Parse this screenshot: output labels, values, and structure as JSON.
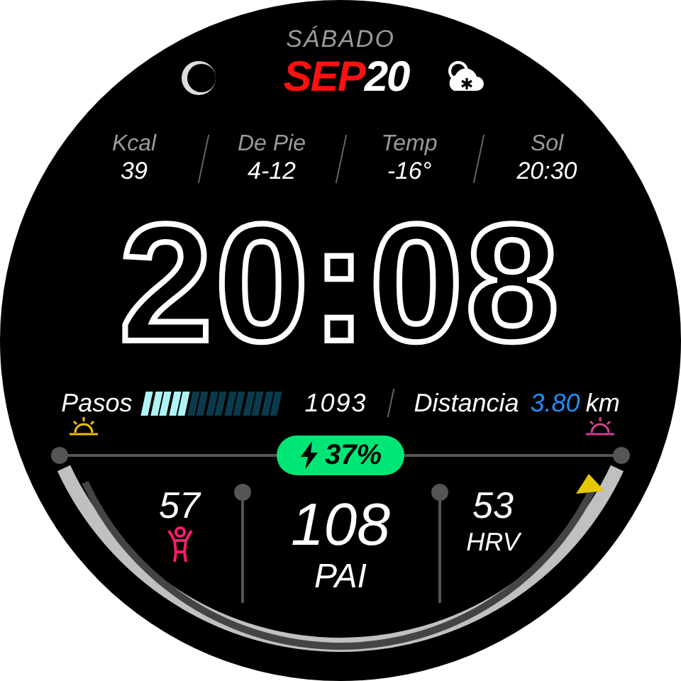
{
  "day": "SÁBADO",
  "month": "SEP",
  "date": "20",
  "stats": [
    {
      "label": "Kcal",
      "value": "39"
    },
    {
      "label": "De Pie",
      "value": "4-12"
    },
    {
      "label": "Temp",
      "value": "-16°"
    },
    {
      "label": "Sol",
      "value": "20:30"
    }
  ],
  "time": "20:08",
  "steps": {
    "label": "Pasos",
    "level": 0.33,
    "value": "1093"
  },
  "distance": {
    "label": "Distancia",
    "value": "3.80",
    "unit": "km"
  },
  "battery": {
    "value": "37%"
  },
  "metrics": [
    {
      "kind": "icon",
      "value": "57"
    },
    {
      "kind": "main",
      "value": "108",
      "label": "PAI"
    },
    {
      "kind": "label",
      "value": "53",
      "label": "HRV"
    }
  ]
}
